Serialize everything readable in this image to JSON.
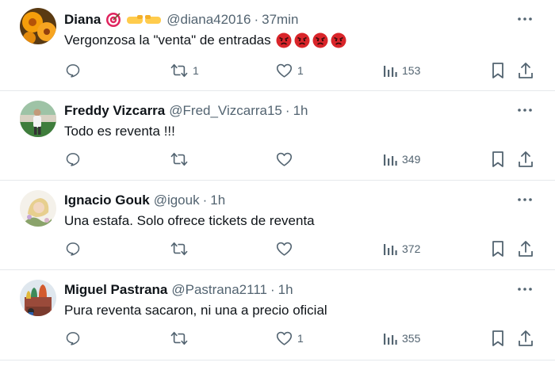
{
  "colors": {
    "text": "#0f1419",
    "muted": "#536471",
    "divider": "#e6e9ec"
  },
  "tweets": [
    {
      "name": "Diana",
      "handle": "@diana42016",
      "sep": "·",
      "time": "37min",
      "text": "Vergonzosa la \"venta\" de entradas",
      "emojis": [
        "angry-face",
        "angry-face",
        "angry-face",
        "angry-face"
      ],
      "badges": [
        "target-emoji",
        "hand-emoji"
      ],
      "replies": "",
      "retweets": "1",
      "likes": "1",
      "views": "153",
      "avatar": "orange-flowers"
    },
    {
      "name": "Freddy Vizcarra",
      "handle": "@Fred_Vizcarra15",
      "sep": "·",
      "time": "1h",
      "text": "Todo es reventa !!!",
      "replies": "",
      "retweets": "",
      "likes": "",
      "views": "349",
      "avatar": "football-field"
    },
    {
      "name": "Ignacio Gouk",
      "handle": "@igouk",
      "sep": "·",
      "time": "1h",
      "text": "Una estafa. Solo ofrece tickets de reventa",
      "replies": "",
      "retweets": "",
      "likes": "",
      "views": "372",
      "avatar": "illustration"
    },
    {
      "name": "Miguel Pastrana",
      "handle": "@Pastrana2111",
      "sep": "·",
      "time": "1h",
      "text": "Pura reventa sacaron, ni una a precio oficial",
      "replies": "",
      "retweets": "",
      "likes": "1",
      "views": "355",
      "avatar": "cathedral"
    }
  ]
}
